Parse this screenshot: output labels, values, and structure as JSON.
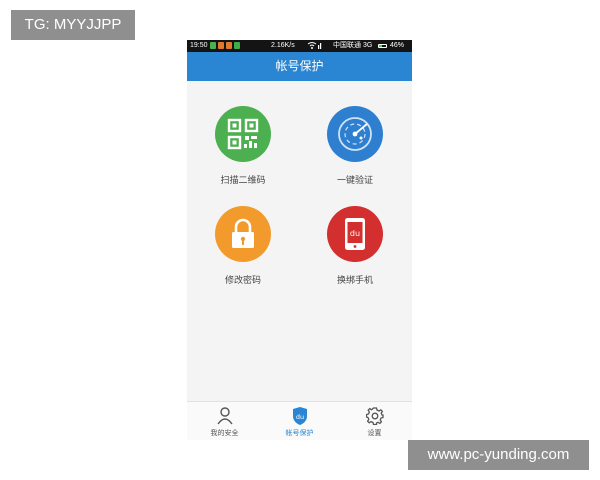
{
  "watermarks": {
    "top_left": "TG: MYYJJPP",
    "bottom_right": "www.pc-yunding.com"
  },
  "status_bar": {
    "time": "19:50",
    "net_speed": "2.16K/s",
    "carrier": "中国联通 3G",
    "battery": "46%"
  },
  "header": {
    "title": "帐号保护"
  },
  "features": [
    {
      "label": "扫描二维码",
      "icon": "qr-code-icon",
      "color": "#4caf50"
    },
    {
      "label": "一键验证",
      "icon": "radar-icon",
      "color": "#2f7fd0"
    },
    {
      "label": "修改密码",
      "icon": "lock-icon",
      "color": "#f39a2c"
    },
    {
      "label": "换绑手机",
      "icon": "phone-icon",
      "color": "#d32f2f"
    }
  ],
  "tabbar": {
    "tabs": [
      {
        "label": "我的安全",
        "icon": "person-icon",
        "active": false
      },
      {
        "label": "帐号保护",
        "icon": "shield-du-icon",
        "active": true
      },
      {
        "label": "设置",
        "icon": "gear-icon",
        "active": false
      }
    ]
  },
  "colors": {
    "primary": "#2a86d2",
    "background": "#f4f4f4"
  },
  "icon_text": {
    "du": "du"
  }
}
